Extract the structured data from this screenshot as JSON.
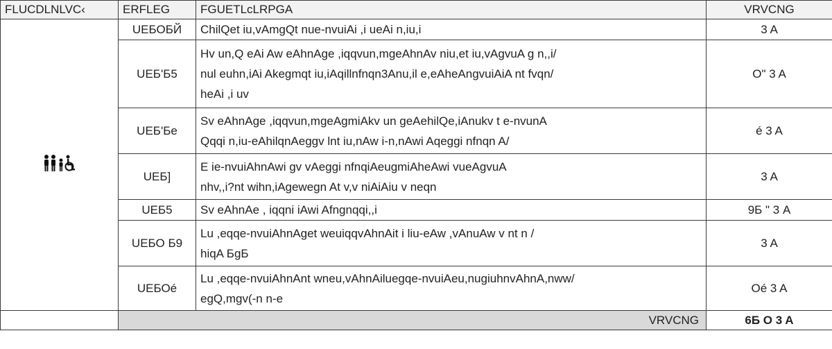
{
  "table": {
    "headers": {
      "category": "FLUCDLNLVC‹",
      "code": "ERFLEG",
      "description": "FGUETLcLRPGA",
      "amount": "VRVCNG"
    },
    "category_icon": "family-accessibility-icon",
    "rows": [
      {
        "code": "UEБОБЙ",
        "lines": [
          "ChilQet iu,vAmgQt nue-nvuiAi ,i ueAi n,iu,i"
        ],
        "amount": "3    A"
      },
      {
        "code": "UEБ'Б5",
        "lines": [
          "Hv un,Q eAi Aw eAhnAge ,iqqvun,mgeAhnAv niu,et iu,vAgvuA g n,,i/",
          "nul euhn,iAi Akegmqt iu,iAqillnfnqn3Anu,il e,eAheAngvuiAiA nt fvqn/",
          "heAi ,i uv"
        ],
        "amount": "O\"    3    A"
      },
      {
        "code": "UEБ'Бe",
        "lines": [
          "Sv eAhnAge ,iqqvun,mgeAgmiAkv un geAehilQe,iAnukv t e-nvunA",
          " Qqqi n,iu-eAhilqnAeggv lnt iu,nAw i-n,nAwi Aqeggi  nfnqn  A/"
        ],
        "amount": "é    3    A"
      },
      {
        "code": "UEБ]",
        "lines": [
          "E ie-nvuiAhnAwi gv  vAeggi  nfnqiAeugmiAheAwi  vueAgvuA",
          " nhv,,i?nt wihn,iAgewegn  At v,v niAiAiu v neqn"
        ],
        "amount": "3    A"
      },
      {
        "code": "UEБ5",
        "lines": [
          "Sv eAhnAe , iqqni iAwi  Afngnqqi,,i"
        ],
        "amount": "9Б \"    3    A"
      },
      {
        "code": "UEБО Б9",
        "lines": [
          "Lu ,eqqe-nvuiAhnAget weuiqqvAhnAit i liu-eAw ,vAnuAw v  nt n  /",
          "hiqA БgБ"
        ],
        "amount": "3    A"
      },
      {
        "code": "UEБОé",
        "lines": [
          "Lu ,eqqe-nvuiAhnAnt wneu,vAhnAiluegqe-nvuiAeu,nugiuhnvAhnA,nww/",
          "egQ,mgv(-n n-e"
        ],
        "amount": "Oé    3    A"
      }
    ],
    "total": {
      "label": "VRVCNG",
      "amount": "6Б O   3    A"
    }
  }
}
